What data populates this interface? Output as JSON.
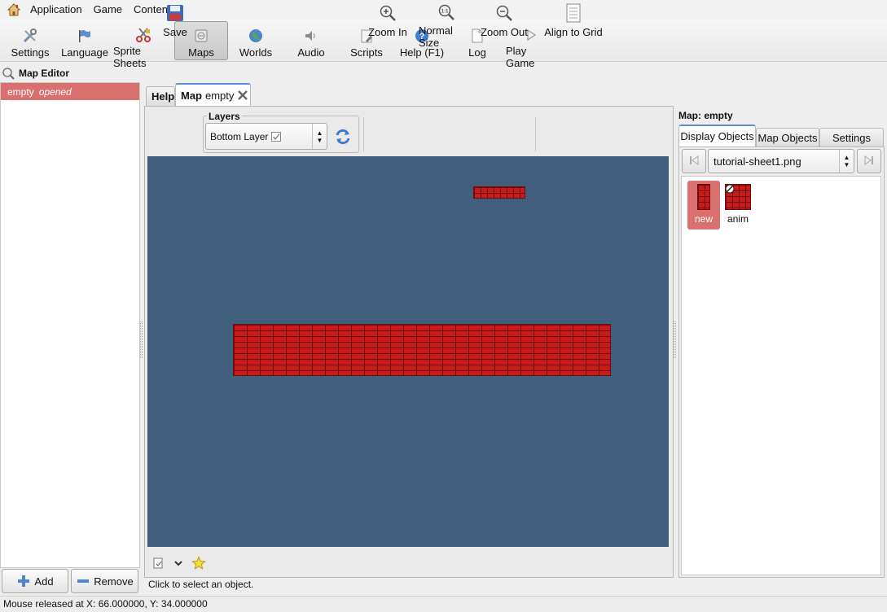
{
  "menubar": {
    "items": [
      "Application",
      "Game",
      "Content"
    ],
    "icons": [
      "home-icon"
    ]
  },
  "toolbar": {
    "buttons": [
      {
        "label": "Settings",
        "icon": "tools-icon"
      },
      {
        "label": "Language",
        "icon": "flag-icon"
      },
      {
        "label": "Sprite Sheets",
        "icon": "scissors-icon"
      },
      {
        "label": "Maps",
        "icon": "map-icon",
        "active": true
      },
      {
        "label": "Worlds",
        "icon": "globe-icon"
      },
      {
        "label": "Audio",
        "icon": "speaker-icon"
      },
      {
        "label": "Scripts",
        "icon": "script-icon"
      },
      {
        "label": "Help (F1)",
        "icon": "help-icon"
      },
      {
        "label": "Log",
        "icon": "document-icon"
      },
      {
        "label": "Play Game",
        "icon": "play-icon"
      }
    ]
  },
  "panel": {
    "title": "Map Editor",
    "items": [
      {
        "name": "empty",
        "status": "opened"
      }
    ],
    "add_label": "Add",
    "remove_label": "Remove"
  },
  "tabs": {
    "help": "Help",
    "map_prefix": "Map",
    "map_name": "empty"
  },
  "map_toolbar": {
    "save": "Save",
    "layers_title": "Layers",
    "layer_value": "Bottom Layer",
    "zoom_in": "Zoom In",
    "normal_size": "Normal Size",
    "zoom_out": "Zoom Out",
    "align_grid": "Align to Grid"
  },
  "canvas": {
    "background": "#415f7c",
    "brick_color": "#c81b1b",
    "hint": "Click to select an object."
  },
  "right_panel": {
    "title": "Map: empty",
    "tabs": [
      "Display Objects",
      "Map Objects",
      "Settings"
    ],
    "sheet": "tutorial-sheet1.png",
    "objects": [
      {
        "label": "new",
        "selected": true
      },
      {
        "label": "anim",
        "selected": false
      }
    ]
  },
  "statusbar": {
    "text": "Mouse released at X: 66.000000, Y: 34.000000"
  }
}
